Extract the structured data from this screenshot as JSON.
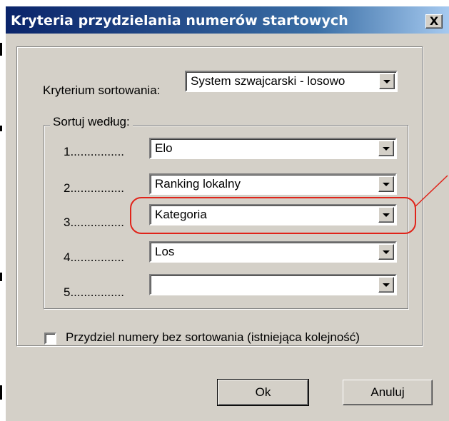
{
  "window": {
    "title": "Kryteria przydzielania numerów startowych",
    "close_label": "X"
  },
  "criterion": {
    "label": "Kryterium sortowania:",
    "value": "System szwajcarski - losowo"
  },
  "sort_by": {
    "legend": "Sortuj według:",
    "rows": [
      {
        "label": "1................",
        "value": "Elo"
      },
      {
        "label": "2................",
        "value": "Ranking lokalny"
      },
      {
        "label": "3................",
        "value": "Kategoria"
      },
      {
        "label": "4................",
        "value": "Los"
      },
      {
        "label": "5................",
        "value": ""
      }
    ]
  },
  "checkbox": {
    "label": "Przydziel numery bez sortowania (istniejąca kolejność)",
    "checked": false
  },
  "buttons": {
    "ok": "Ok",
    "cancel": "Anuluj"
  },
  "colors": {
    "title_bar_start": "#0a246a",
    "title_bar_end": "#a6caf0",
    "dialog_face": "#d4d0c8",
    "annotation": "#e0241a"
  }
}
